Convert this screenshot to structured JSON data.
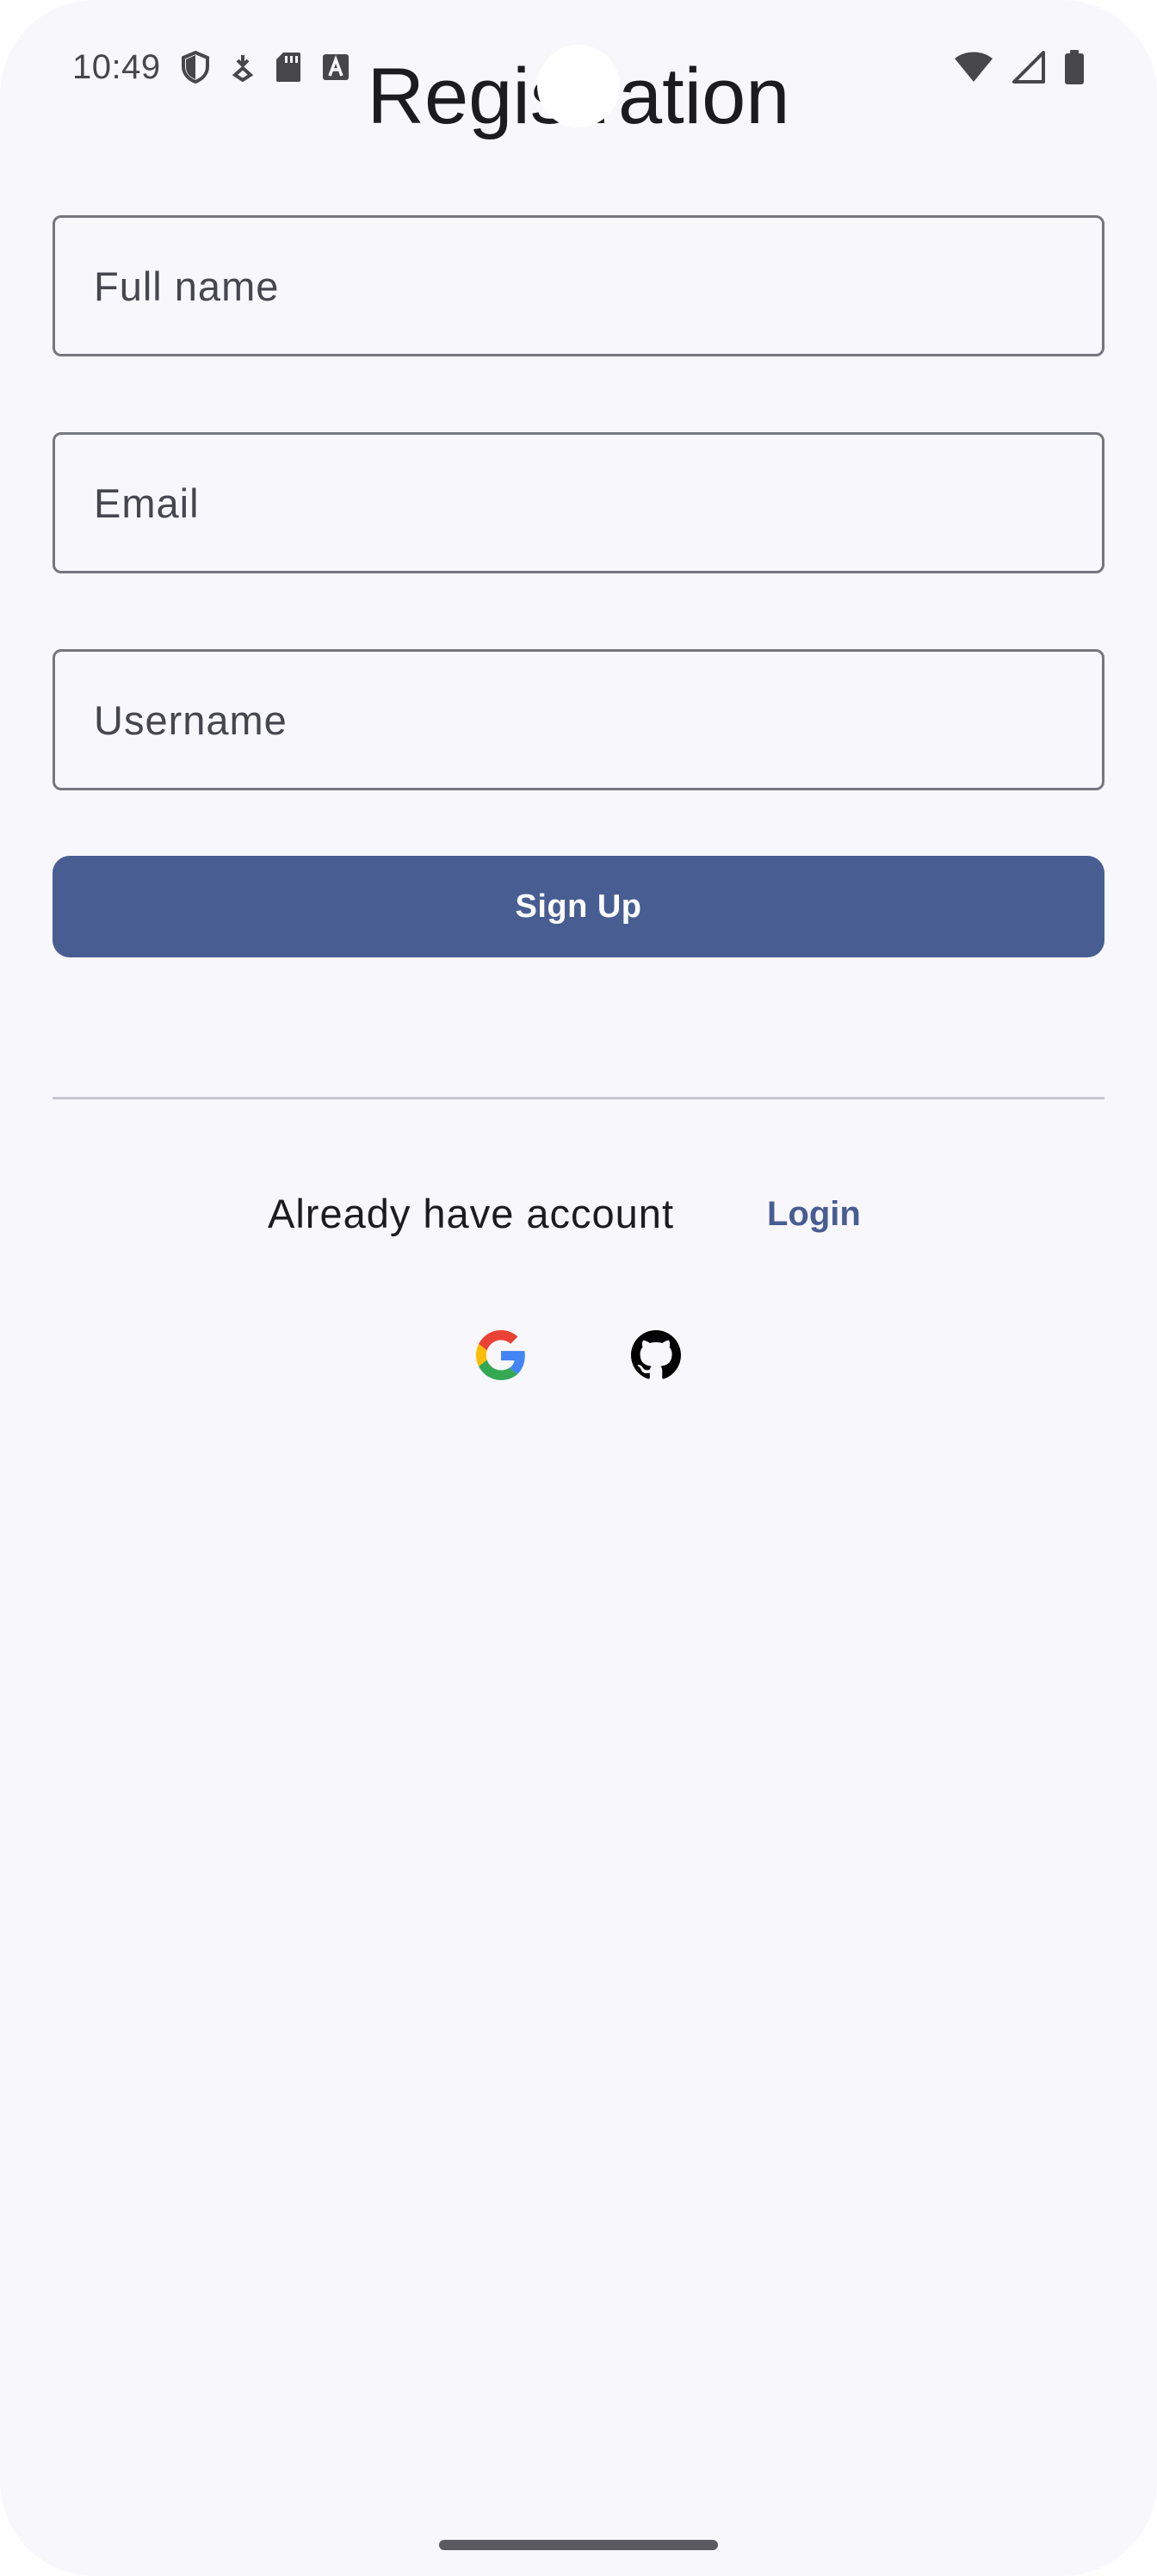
{
  "status_bar": {
    "time": "10:49",
    "left_icons": [
      "shield-icon",
      "download-icon",
      "sd-card-icon",
      "font-icon"
    ],
    "right_icons": [
      "wifi-icon",
      "cell-signal-icon",
      "battery-icon"
    ]
  },
  "page": {
    "title": "Registration"
  },
  "form": {
    "full_name_placeholder": "Full name",
    "email_placeholder": "Email",
    "username_placeholder": "Username",
    "signup_label": "Sign Up"
  },
  "footer": {
    "account_text": "Already have account",
    "login_label": "Login"
  },
  "social": [
    "google-icon",
    "github-icon"
  ],
  "colors": {
    "background": "#f8f7fc",
    "primary": "#485d92",
    "outline": "#76767e",
    "divider": "#c6c5cf",
    "text": "#1b1b20"
  }
}
